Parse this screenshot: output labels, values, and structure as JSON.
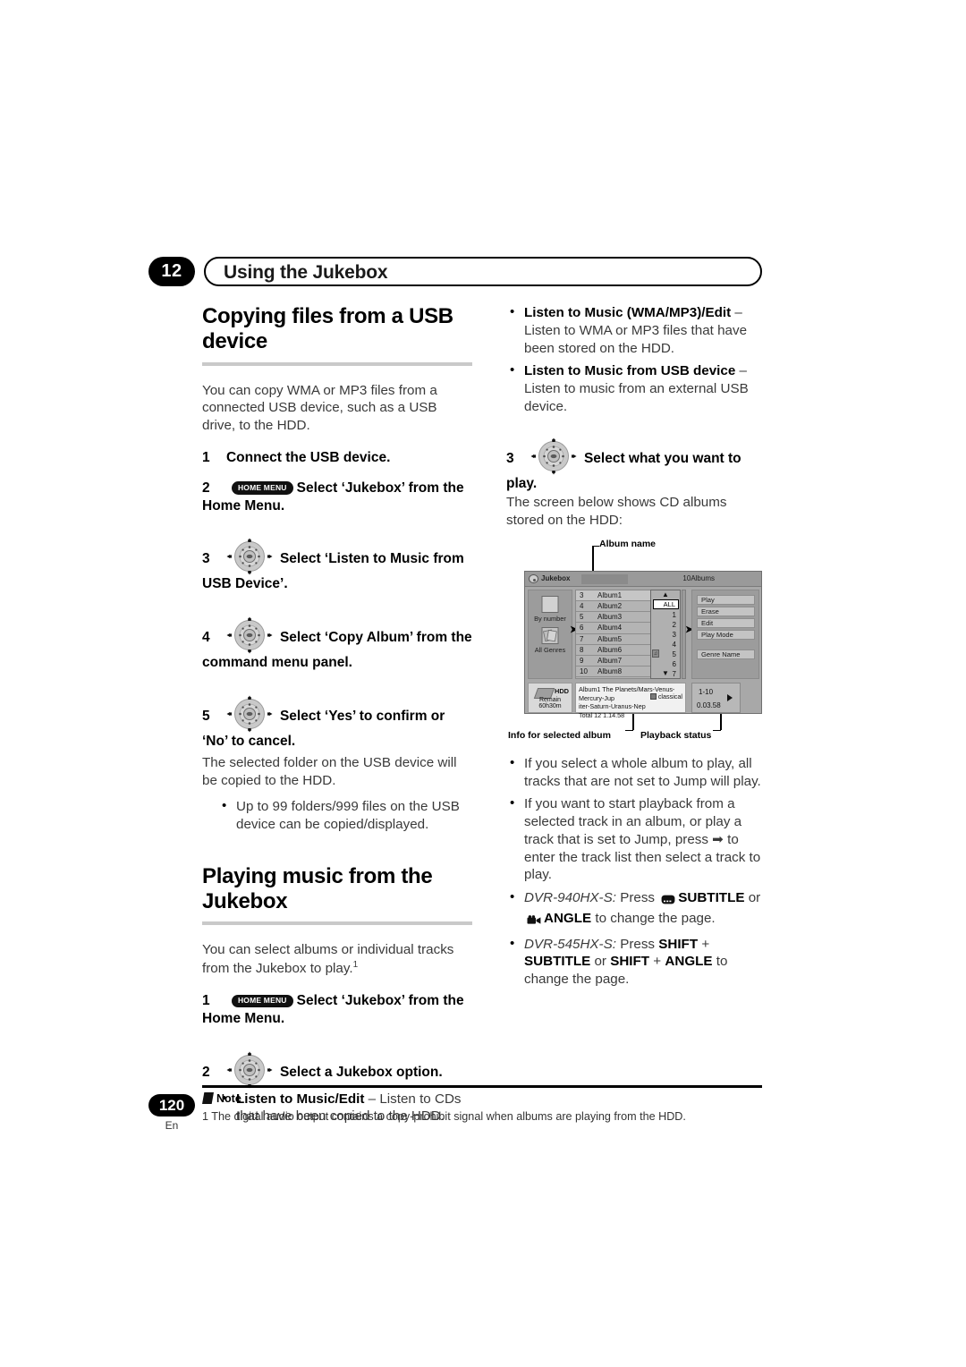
{
  "chapter": {
    "number": "12",
    "title": "Using the Jukebox"
  },
  "left": {
    "heading1": "Copying files from a USB device",
    "intro1": "You can copy WMA or MP3 files from a connected USB device, such as a USB drive, to the HDD.",
    "steps": [
      {
        "n": "1",
        "icon": "none",
        "text": "Connect the USB device."
      },
      {
        "n": "2",
        "icon": "home-menu",
        "text": "Select ‘Jukebox’ from the Home Menu."
      },
      {
        "n": "3",
        "icon": "dpad",
        "text": "Select ‘Listen to Music from USB Device’."
      },
      {
        "n": "4",
        "icon": "dpad",
        "text": "Select ‘Copy Album’ from the command menu panel."
      },
      {
        "n": "5",
        "icon": "dpad",
        "text": "Select ‘Yes’ to confirm or ‘No’ to cancel."
      }
    ],
    "step5_note": "The selected folder on the USB device will be copied to the HDD.",
    "step5_bullet": "Up to 99 folders/999 files on the USB device can be copied/displayed.",
    "heading2": "Playing music from the Jukebox",
    "intro2_a": "You can select albums or individual tracks from the Jukebox to play.",
    "intro2_sup": "1",
    "steps2": [
      {
        "n": "1",
        "icon": "home-menu",
        "text": "Select ‘Jukebox’ from the Home Menu."
      },
      {
        "n": "2",
        "icon": "dpad",
        "text": "Select a Jukebox option."
      }
    ],
    "option1_bold": "Listen to Music/Edit",
    "option1_rest": " – Listen to CDs that have been copied to the HDD."
  },
  "right": {
    "options": [
      {
        "bold": "Listen to Music (WMA/MP3)/Edit",
        "rest": " – Listen to WMA or MP3 files that have been stored on the HDD."
      },
      {
        "bold": "Listen to Music from USB device",
        "rest": " – Listen to music from an external USB device."
      }
    ],
    "step3": {
      "n": "3",
      "icon": "dpad",
      "text": "Select what you want to play."
    },
    "step3_note": "The screen below shows CD albums stored on the HDD:",
    "notes": [
      "If you select a whole album to play, all tracks that are not set to Jump will play.",
      "If you want to start playback from a selected track in an album, or play a track that is set to Jump, press ➡ to enter the track list then select a track to play."
    ],
    "model_notes": [
      {
        "model": "DVR-940HX-S:",
        "pre": " Press ",
        "icon1": "subtitle-icon",
        "k1": "SUBTITLE",
        "mid": " or ",
        "icon2": "angle-icon",
        "k2": "ANGLE",
        "post": " to change the page."
      },
      {
        "model": "DVR-545HX-S:",
        "pre": " Press ",
        "k1": "SHIFT",
        "plus": " + ",
        "k2": "SUBTITLE",
        "mid": " or ",
        "k3": "SHIFT",
        "plus2": " + ",
        "k4": "ANGLE",
        "post": " to change the page."
      }
    ]
  },
  "figure": {
    "callouts": {
      "album_name": "Album name",
      "info_album": "Info for selected album",
      "playback_status": "Playback status"
    },
    "osd": {
      "title": "Jukebox",
      "albums_count": "10Albums",
      "left_panel": [
        {
          "label": "By number",
          "icon": "page-icon"
        },
        {
          "label": "All Genres",
          "icon": "genres-icon"
        }
      ],
      "storage": {
        "label": "HDD",
        "remain_line1": "Remain",
        "remain_line2": "60h30m"
      },
      "list": [
        {
          "num": "3",
          "name": "Album1",
          "selected": true
        },
        {
          "num": "4",
          "name": "Album2",
          "selected": false
        },
        {
          "num": "5",
          "name": "Album3",
          "selected": false
        },
        {
          "num": "6",
          "name": "Album4",
          "selected": false
        },
        {
          "num": "7",
          "name": "Album5",
          "selected": false
        },
        {
          "num": "8",
          "name": "Album6",
          "selected": false
        },
        {
          "num": "9",
          "name": "Album7",
          "selected": false
        },
        {
          "num": "10",
          "name": "Album8",
          "selected": false
        }
      ],
      "page_column": {
        "up_arrow": "▲",
        "down_arrow": "▼",
        "selected": "ALL",
        "items": [
          "1",
          "2",
          "3",
          "4",
          "5",
          "6",
          "7"
        ],
        "mark_on": "5"
      },
      "commands": [
        "Play",
        "Erase",
        "Edit",
        "Play Mode",
        "Genre Name"
      ],
      "info": {
        "line1": "Album1  The Planets/Mars-Venus-Mercury-Jup",
        "line2": "iter-Saturn-Uranus-Nep",
        "genre": "classical",
        "line3": "Total 12  1.14.58"
      },
      "playback": {
        "range": "1-10",
        "time": "0.03.58"
      }
    }
  },
  "footer": {
    "page": "120",
    "lang": "En",
    "note_label": "Note",
    "note_text": "1 The digital audio output contains a copy-prohibit signal when albums are playing from the HDD."
  }
}
